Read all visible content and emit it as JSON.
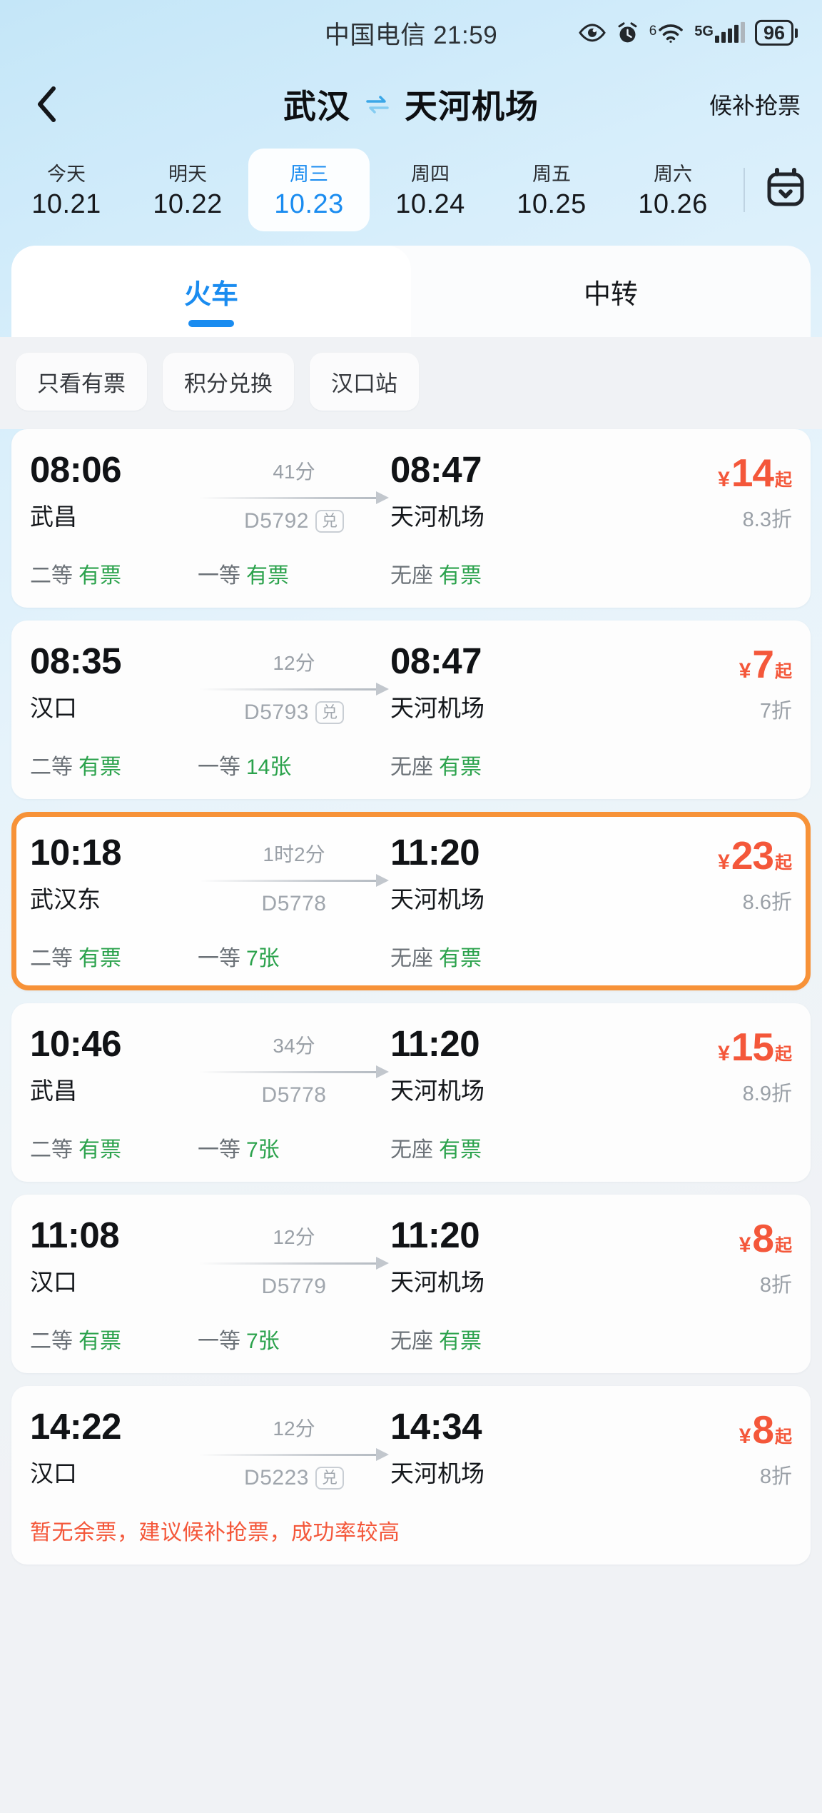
{
  "status_bar": {
    "carrier_time": "中国电信 21:59",
    "icons": [
      "eye-care-icon",
      "alarm-clock-icon",
      "wifi6-icon",
      "5g-signal-icon"
    ],
    "wifi_label": "6",
    "network_label": "5G",
    "battery_level": "96"
  },
  "header": {
    "back_icon": "chevron-left-icon",
    "from_station": "武汉",
    "swap_icon": "swap-arrows-icon",
    "to_station": "天河机场",
    "waitlist_label": "候补抢票"
  },
  "dates": {
    "items": [
      {
        "dow": "今天",
        "date": "10.21",
        "active": false
      },
      {
        "dow": "明天",
        "date": "10.22",
        "active": false
      },
      {
        "dow": "周三",
        "date": "10.23",
        "active": true
      },
      {
        "dow": "周四",
        "date": "10.24",
        "active": false
      },
      {
        "dow": "周五",
        "date": "10.25",
        "active": false
      },
      {
        "dow": "周六",
        "date": "10.26",
        "active": false
      }
    ],
    "calendar_icon": "calendar-icon"
  },
  "tabs": [
    {
      "label": "火车",
      "active": true
    },
    {
      "label": "中转",
      "active": false
    }
  ],
  "filters": [
    {
      "label": "只看有票"
    },
    {
      "label": "积分兑换"
    },
    {
      "label": "汉口站"
    }
  ],
  "seat_labels": {
    "second": "二等",
    "first": "一等",
    "standing": "无座"
  },
  "price_prefix": "¥",
  "price_suffix": "起",
  "exchange_badge": "兑",
  "trains": [
    {
      "depart_time": "08:06",
      "depart_station": "武昌",
      "duration": "41分",
      "train_no": "D5792",
      "has_exchange": true,
      "arrive_time": "08:47",
      "arrive_station": "天河机场",
      "price": "14",
      "discount": "8.3折",
      "seats": [
        {
          "name": "二等",
          "status": "有票"
        },
        {
          "name": "一等",
          "status": "有票"
        },
        {
          "name": "无座",
          "status": "有票"
        }
      ],
      "notice": "",
      "selected": false
    },
    {
      "depart_time": "08:35",
      "depart_station": "汉口",
      "duration": "12分",
      "train_no": "D5793",
      "has_exchange": true,
      "arrive_time": "08:47",
      "arrive_station": "天河机场",
      "price": "7",
      "discount": "7折",
      "seats": [
        {
          "name": "二等",
          "status": "有票"
        },
        {
          "name": "一等",
          "status": "14张"
        },
        {
          "name": "无座",
          "status": "有票"
        }
      ],
      "notice": "",
      "selected": false
    },
    {
      "depart_time": "10:18",
      "depart_station": "武汉东",
      "duration": "1时2分",
      "train_no": "D5778",
      "has_exchange": false,
      "arrive_time": "11:20",
      "arrive_station": "天河机场",
      "price": "23",
      "discount": "8.6折",
      "seats": [
        {
          "name": "二等",
          "status": "有票"
        },
        {
          "name": "一等",
          "status": "7张"
        },
        {
          "name": "无座",
          "status": "有票"
        }
      ],
      "notice": "",
      "selected": true
    },
    {
      "depart_time": "10:46",
      "depart_station": "武昌",
      "duration": "34分",
      "train_no": "D5778",
      "has_exchange": false,
      "arrive_time": "11:20",
      "arrive_station": "天河机场",
      "price": "15",
      "discount": "8.9折",
      "seats": [
        {
          "name": "二等",
          "status": "有票"
        },
        {
          "name": "一等",
          "status": "7张"
        },
        {
          "name": "无座",
          "status": "有票"
        }
      ],
      "notice": "",
      "selected": false
    },
    {
      "depart_time": "11:08",
      "depart_station": "汉口",
      "duration": "12分",
      "train_no": "D5779",
      "has_exchange": false,
      "arrive_time": "11:20",
      "arrive_station": "天河机场",
      "price": "8",
      "discount": "8折",
      "seats": [
        {
          "name": "二等",
          "status": "有票"
        },
        {
          "name": "一等",
          "status": "7张"
        },
        {
          "name": "无座",
          "status": "有票"
        }
      ],
      "notice": "",
      "selected": false
    },
    {
      "depart_time": "14:22",
      "depart_station": "汉口",
      "duration": "12分",
      "train_no": "D5223",
      "has_exchange": true,
      "arrive_time": "14:34",
      "arrive_station": "天河机场",
      "price": "8",
      "discount": "8折",
      "seats": [],
      "notice": "暂无余票，建议候补抢票，成功率较高",
      "selected": false
    }
  ],
  "colors": {
    "accent_blue": "#1a8cf0",
    "price_red": "#f4573a",
    "available_green": "#2ba24c",
    "selected_border": "#f79238"
  }
}
